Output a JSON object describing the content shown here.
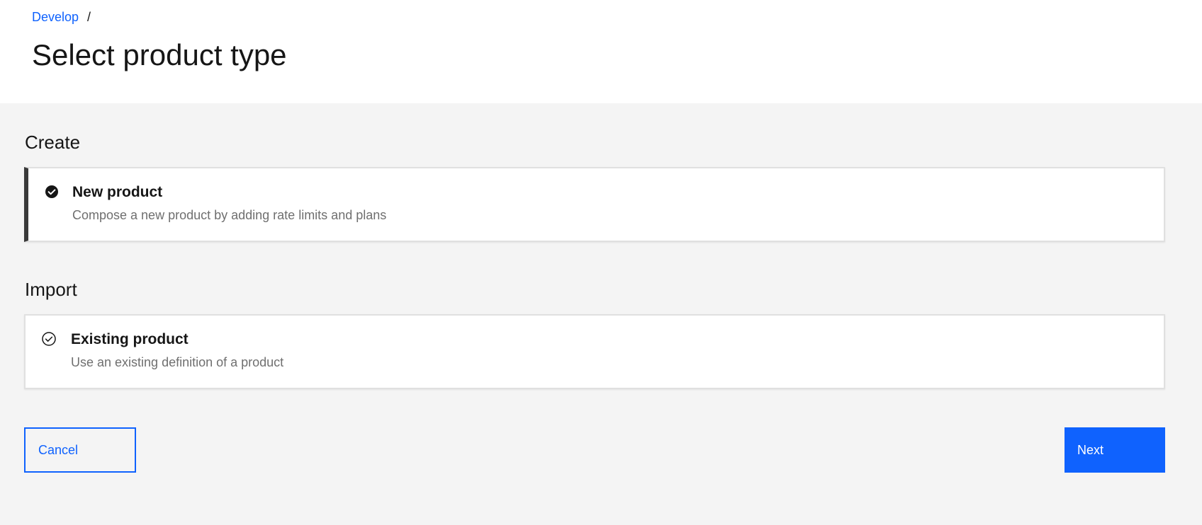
{
  "breadcrumb": {
    "items": [
      {
        "label": "Develop"
      }
    ],
    "separator": "/"
  },
  "page": {
    "title": "Select product type"
  },
  "sections": {
    "create": {
      "title": "Create",
      "tile": {
        "title": "New product",
        "description": "Compose a new product by adding rate limits and plans",
        "selected": true,
        "icon": "checkmark-filled-icon"
      }
    },
    "import": {
      "title": "Import",
      "tile": {
        "title": "Existing product",
        "description": "Use an existing definition of a product",
        "selected": false,
        "icon": "checkmark-outline-icon"
      }
    }
  },
  "actions": {
    "cancel_label": "Cancel",
    "next_label": "Next"
  },
  "colors": {
    "primary": "#0f62fe",
    "background": "#f4f4f4",
    "surface": "#ffffff",
    "text": "#161616",
    "text_secondary": "#6f6f6f",
    "selected_border": "#393939"
  }
}
